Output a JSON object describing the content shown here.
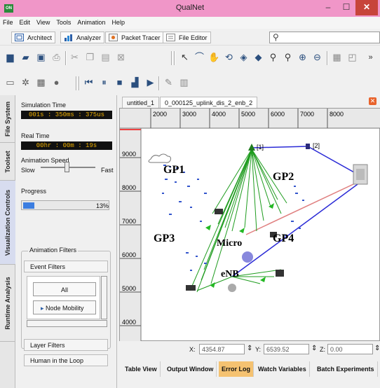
{
  "window": {
    "title": "QualNet",
    "app_icon": "ON",
    "min": "–",
    "max": "☐",
    "close": "✕"
  },
  "menu": [
    "File",
    "Edit",
    "View",
    "Tools",
    "Animation",
    "Help"
  ],
  "modes": {
    "architect": "Architect",
    "analyzer": "Analyzer",
    "packet_tracer": "Packet Tracer",
    "file_editor": "File Editor"
  },
  "search": {
    "placeholder": ""
  },
  "sidebar_tabs": [
    "File System",
    "Toolset",
    "Visualization Controls",
    "Runtime Analysis"
  ],
  "panel": {
    "sim_time_label": "Simulation Time",
    "sim_time": "001s : 350ms : 375us",
    "real_time_label": "Real Time",
    "real_time": "00hr : 00m : 19s",
    "speed_label": "Animation Speed",
    "slow": "Slow",
    "fast": "Fast",
    "progress_label": "Progress",
    "progress_pct": "13%",
    "progress_value": 0.13,
    "filters_title": "Animation Filters",
    "event_filters": "Event Filters",
    "all": "All",
    "node_mobility": "Node Mobility",
    "layer_filters": "Layer Filters",
    "human_loop": "Human in the Loop"
  },
  "doc_tabs": [
    "untitled_1",
    "0_000125_uplink_dis_2_enb_2"
  ],
  "ruler": {
    "x_ticks": [
      "2000",
      "3000",
      "4000",
      "5000",
      "6000",
      "7000",
      "8000"
    ],
    "y_ticks": [
      "9000",
      "8000",
      "7000",
      "6000",
      "5000",
      "4000"
    ]
  },
  "scene": {
    "labels": {
      "gp1": "GP1",
      "gp2": "GP2",
      "gp3": "GP3",
      "gp4": "GP4",
      "micro": "Micro",
      "enb": "eNB"
    },
    "node_ids": [
      "[1]",
      "[2]"
    ]
  },
  "coords": {
    "x_label": "X:",
    "x": "4354.87",
    "y_label": "Y:",
    "y": "6539.52",
    "z_label": "Z:",
    "z": "0.00"
  },
  "bottom_tabs": [
    "Table View",
    "Output Window",
    "Error Log",
    "Watch Variables",
    "Batch Experiments"
  ],
  "colors": {
    "titlebar": "#f096c8",
    "active_tab": "#f5c271",
    "time_text": "#f0b000",
    "link_green": "#1f9c1f",
    "link_blue": "#2a2ad6",
    "link_red": "#e08080"
  }
}
